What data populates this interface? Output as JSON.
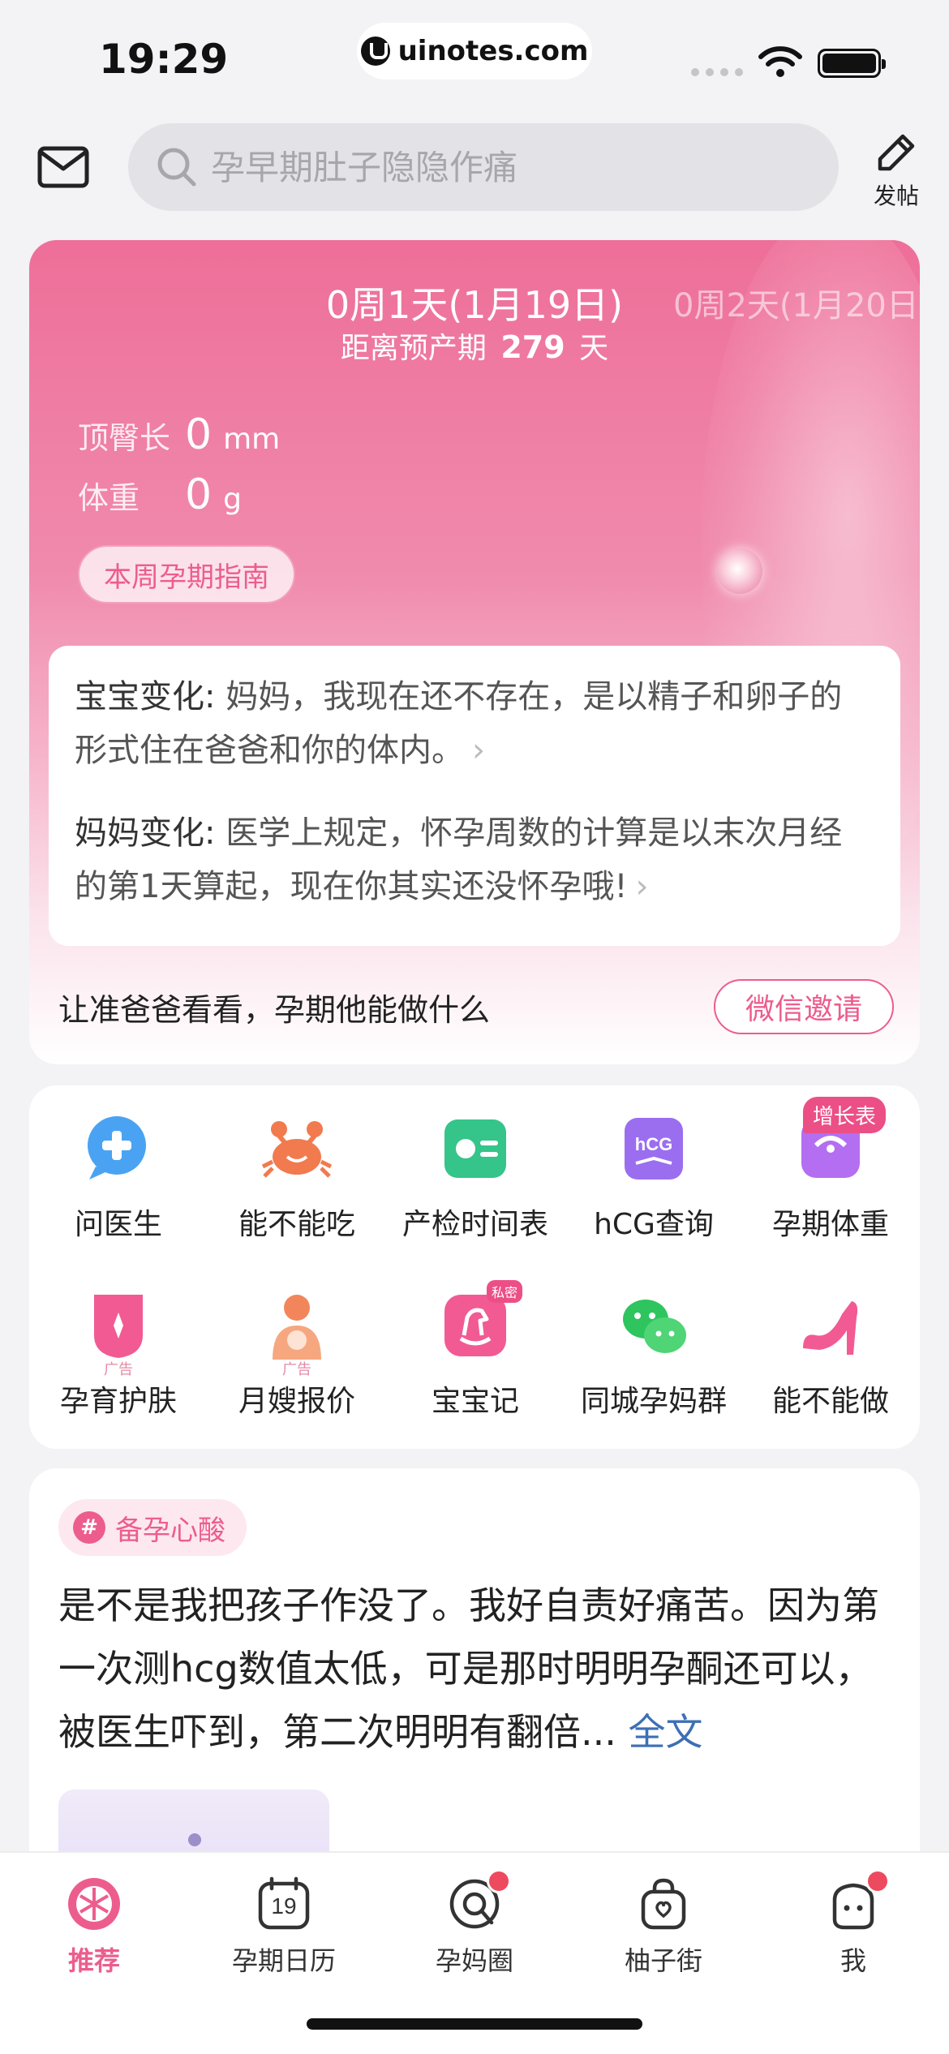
{
  "status_bar": {
    "time": "19:29",
    "url": "uinotes.com"
  },
  "header": {
    "search_placeholder": "孕早期肚子隐隐作痛",
    "post_label": "发帖"
  },
  "pregnancy": {
    "week_title": "0周1天(1月19日)",
    "week_next": "0周2天(1月20日",
    "due_prefix": "距离预产期",
    "due_days": "279",
    "due_suffix": "天",
    "crown_rump_label": "顶臀长",
    "crown_rump_value": "0",
    "crown_rump_unit": "mm",
    "weight_label": "体重",
    "weight_value": "0",
    "weight_unit": "g",
    "guide_button": "本周孕期指南",
    "baby_change_head": "宝宝变化:",
    "baby_change_text": "妈妈，我现在还不存在，是以精子和卵子的形式住在爸爸和你的体内。",
    "mom_change_head": "妈妈变化:",
    "mom_change_text": "医学上规定，怀孕周数的计算是以末次月经的第1天算起，现在你其实还没怀孕哦!",
    "invite_text": "让准爸爸看看，孕期他能做什么",
    "invite_button": "微信邀请"
  },
  "tools": {
    "items": [
      {
        "label": "问医生",
        "icon": "doctor-chat-icon"
      },
      {
        "label": "能不能吃",
        "icon": "crab-icon"
      },
      {
        "label": "产检时间表",
        "icon": "checkup-schedule-icon"
      },
      {
        "label": "hCG查询",
        "icon": "hcg-icon"
      },
      {
        "label": "孕期体重",
        "icon": "scale-icon"
      },
      {
        "label": "孕育护肤",
        "icon": "skincare-icon"
      },
      {
        "label": "月嫂报价",
        "icon": "nanny-icon"
      },
      {
        "label": "宝宝记",
        "icon": "rocking-horse-icon"
      },
      {
        "label": "同城孕妈群",
        "icon": "wechat-group-icon"
      },
      {
        "label": "能不能做",
        "icon": "high-heel-icon"
      }
    ],
    "grow_badge": "增长表",
    "private_badge": "私密",
    "ad_label": "广告"
  },
  "post": {
    "tag": "备孕心酸",
    "tag_icon": "#",
    "text": "是不是我把孩子作没了。我好自责好痛苦。因为第一次测hcg数值太低，可是那时明明孕酮还可以，被医生吓到，第二次明明有翻倍...",
    "more": "全文"
  },
  "tab_bar": {
    "tabs": [
      {
        "label": "推荐",
        "icon": "grapefruit-icon"
      },
      {
        "label": "孕期日历",
        "icon": "calendar-icon",
        "calendar_day": "19"
      },
      {
        "label": "孕妈圈",
        "icon": "circle-chat-icon"
      },
      {
        "label": "柚子街",
        "icon": "shopping-bag-icon"
      },
      {
        "label": "我",
        "icon": "profile-icon"
      }
    ]
  },
  "colors": {
    "accent": "#ec5d8e",
    "link": "#3d6fb4",
    "notify": "#ee4a5f"
  }
}
